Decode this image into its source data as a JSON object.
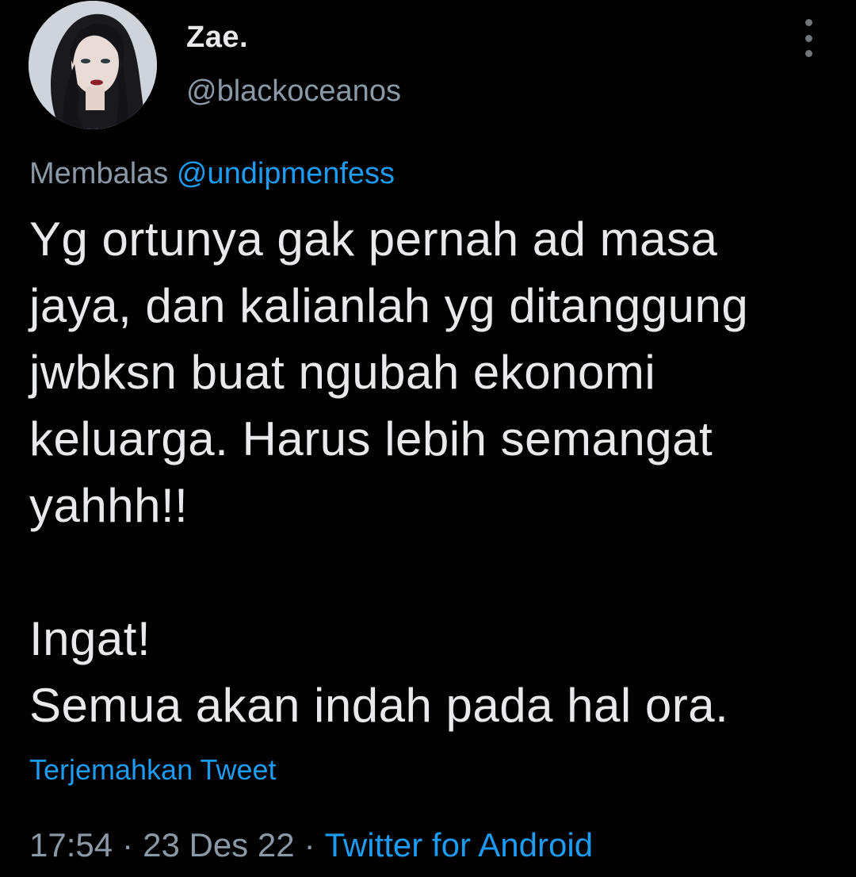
{
  "author": {
    "display_name": "Zae.",
    "handle": "@blackoceanos"
  },
  "reply": {
    "prefix": "Membalas",
    "mention": "@undipmenfess"
  },
  "tweet": {
    "lines": [
      "Yg ortunya gak pernah ad masa",
      "jaya, dan kalianlah yg ditanggung",
      "jwbksn buat ngubah ekonomi",
      "keluarga. Harus lebih semangat",
      "yahhh!!",
      "",
      "Ingat!",
      "Semua akan indah pada hal ora."
    ]
  },
  "translate_label": "Terjemahkan Tweet",
  "meta": {
    "time": "17:54",
    "date": "23 Des 22",
    "separator": "·",
    "source": "Twitter for Android"
  },
  "icons": {
    "more": "more-vertical-icon"
  },
  "colors": {
    "background": "#000000",
    "text": "#e7e9ea",
    "secondary": "#8b98a5",
    "accent": "#1d9bf0"
  }
}
